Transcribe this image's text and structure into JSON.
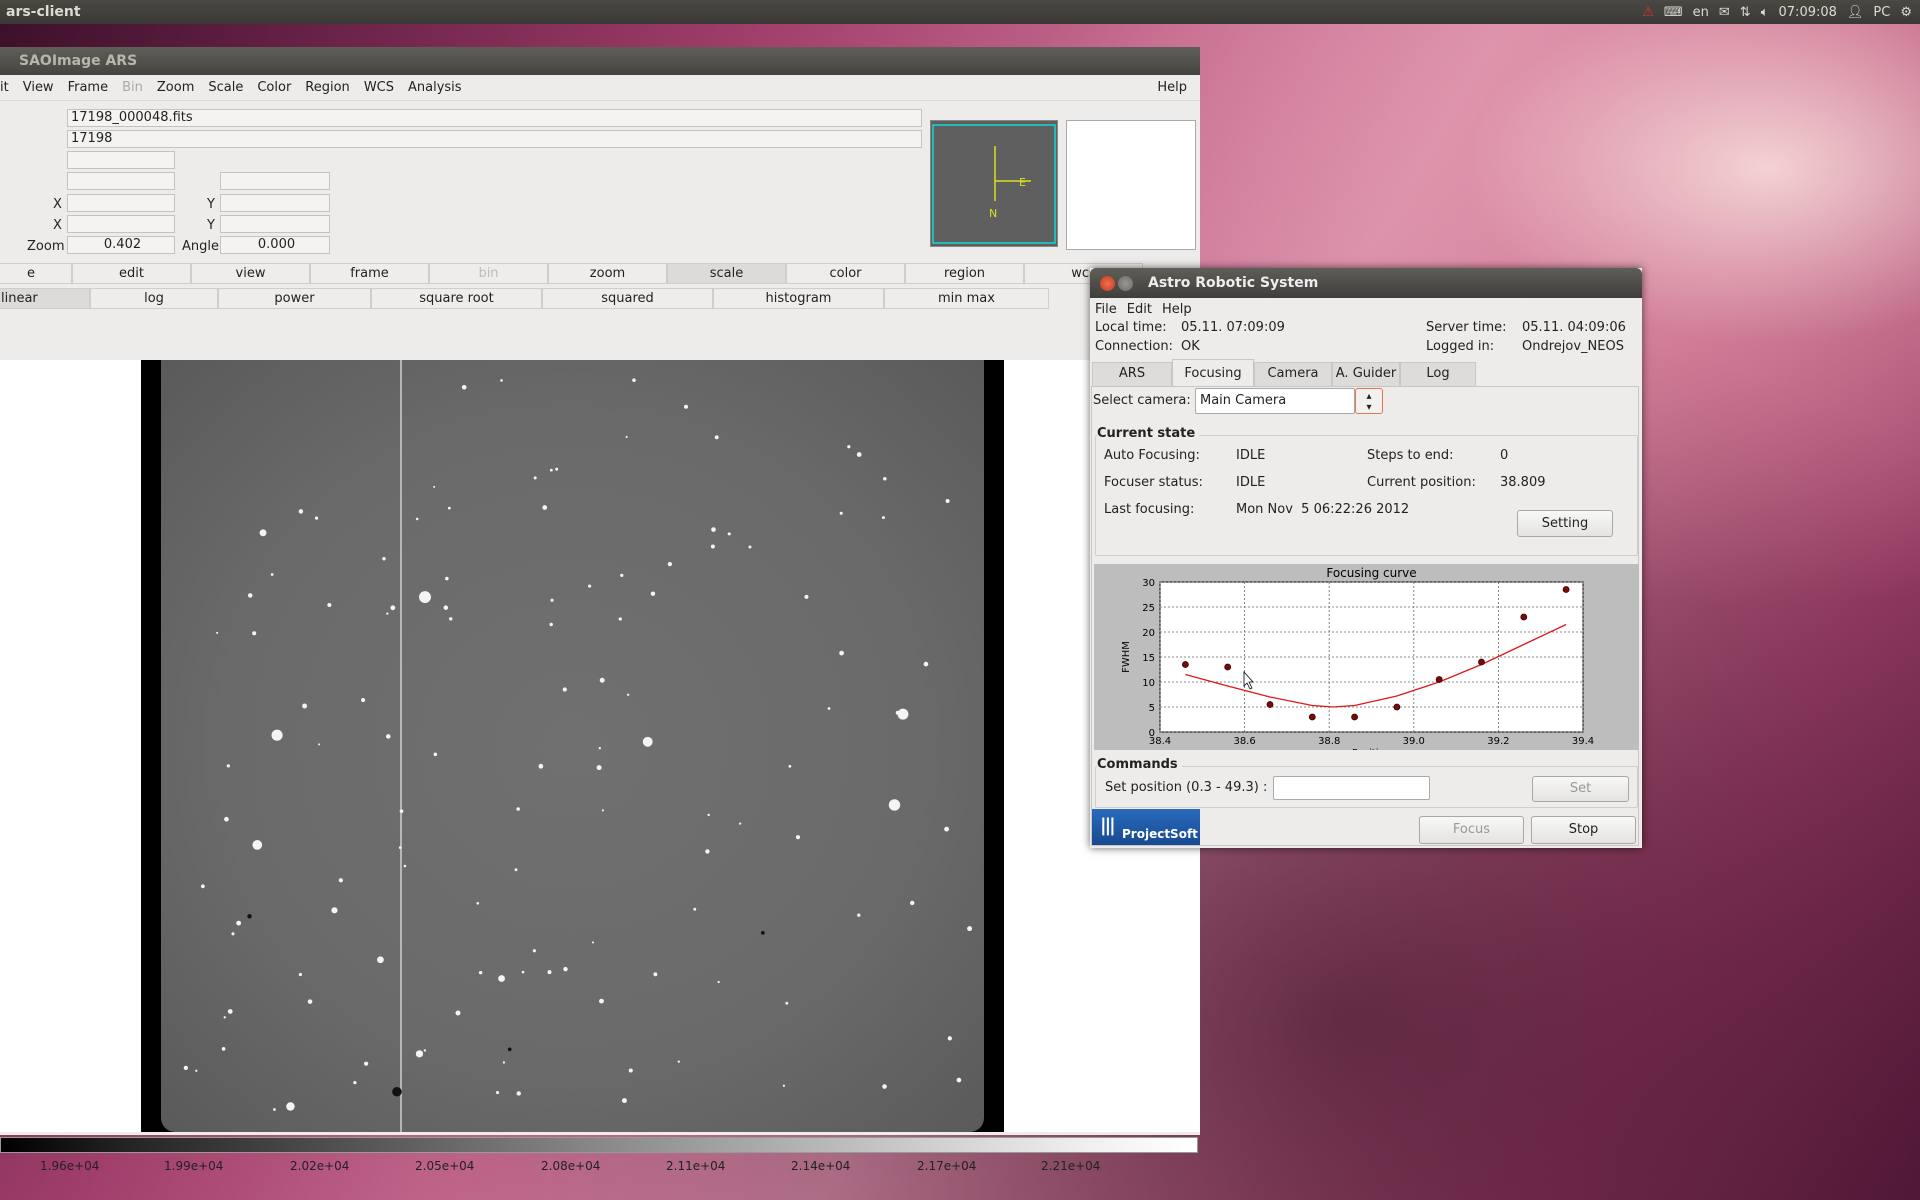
{
  "topbar": {
    "app_title": "ars-client",
    "lang": "en",
    "clock": "07:09:08",
    "user": "PC"
  },
  "sao": {
    "title": "SAOImage ARS",
    "menu": [
      "it",
      "View",
      "Frame",
      "Bin",
      "Zoom",
      "Scale",
      "Color",
      "Region",
      "WCS",
      "Analysis"
    ],
    "menu_help": "Help",
    "file_value": "17198_000048.fits",
    "object_value": "17198",
    "x_label": "X",
    "y_label": "Y",
    "zoom_label": "Zoom",
    "zoom_value": "0.402",
    "angle_label": "Angle",
    "angle_value": "0.000",
    "button_row": [
      "e",
      "edit",
      "view",
      "frame",
      "bin",
      "zoom",
      "scale",
      "color",
      "region",
      "wcs"
    ],
    "scale_row": [
      "linear",
      "log",
      "power",
      "square root",
      "squared",
      "histogram",
      "min max"
    ],
    "compass_labels": [
      "E",
      "N"
    ],
    "colorbar_ticks": [
      "1.96e+04",
      "1.99e+04",
      "2.02e+04",
      "2.05e+04",
      "2.08e+04",
      "2.11e+04",
      "2.14e+04",
      "2.17e+04",
      "2.21e+04"
    ]
  },
  "ars": {
    "title": "Astro Robotic System",
    "menu": [
      "File",
      "Edit",
      "Help"
    ],
    "local_time_label": "Local time:",
    "local_time": "05.11. 07:09:09",
    "connection_label": "Connection:",
    "connection": "OK",
    "server_time_label": "Server time:",
    "server_time": "05.11. 04:09:06",
    "logged_in_label": "Logged in:",
    "logged_in": "Ondrejov_NEOS",
    "tabs": [
      "ARS",
      "Focusing",
      "Camera",
      "A. Guider",
      "Log"
    ],
    "select_camera_label": "Select camera:",
    "select_camera_value": "Main Camera",
    "current_state_title": "Current state",
    "auto_focusing_label": "Auto Focusing:",
    "auto_focusing": "IDLE",
    "steps_label": "Steps to end:",
    "steps": "0",
    "focuser_status_label": "Focuser status:",
    "focuser_status": "IDLE",
    "current_pos_label": "Current position:",
    "current_pos": "38.809",
    "last_focusing_label": "Last focusing:",
    "last_focusing": "Mon Nov  5 06:22:26 2012",
    "setting_button": "Setting",
    "commands_title": "Commands",
    "set_position_label": "Set position (0.3 - 49.3) :",
    "set_button": "Set",
    "focus_button": "Focus",
    "stop_button": "Stop",
    "logo_text": "ProjectSoft"
  },
  "chart_data": {
    "type": "scatter",
    "title": "Focusing curve",
    "xlabel": "Position",
    "ylabel": "FWHM",
    "xlim": [
      38.4,
      39.4
    ],
    "ylim": [
      0,
      30
    ],
    "xticks": [
      "38.4",
      "38.6",
      "38.8",
      "39.0",
      "39.2",
      "39.4"
    ],
    "yticks": [
      "0",
      "5",
      "10",
      "15",
      "20",
      "25",
      "30"
    ],
    "grid": true,
    "points": [
      [
        38.46,
        13.5
      ],
      [
        38.56,
        13
      ],
      [
        38.66,
        5.5
      ],
      [
        38.76,
        3
      ],
      [
        38.86,
        3
      ],
      [
        38.96,
        5
      ],
      [
        39.06,
        10.5
      ],
      [
        39.16,
        14
      ],
      [
        39.26,
        23
      ],
      [
        39.36,
        28.5
      ]
    ],
    "fit": [
      [
        38.46,
        11.5
      ],
      [
        38.56,
        9.2
      ],
      [
        38.66,
        7
      ],
      [
        38.76,
        5.3
      ],
      [
        38.81,
        5
      ],
      [
        38.86,
        5.3
      ],
      [
        38.96,
        7.2
      ],
      [
        39.06,
        10
      ],
      [
        39.16,
        13.5
      ],
      [
        39.26,
        17.5
      ],
      [
        39.36,
        21.5
      ]
    ],
    "colors": {
      "points": "#7a0a0a",
      "fit": "#e01818"
    }
  }
}
